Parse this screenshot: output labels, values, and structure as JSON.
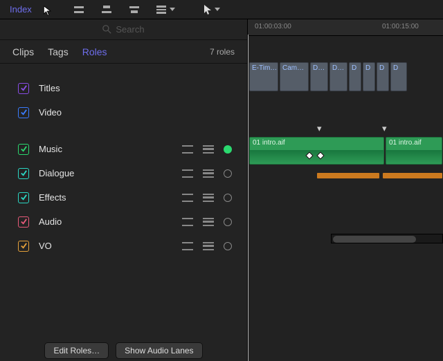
{
  "topbar": {
    "index_label": "Index"
  },
  "search": {
    "placeholder": "Search"
  },
  "tabs": {
    "clips": "Clips",
    "tags": "Tags",
    "roles": "Roles",
    "count": "7 roles"
  },
  "roles": {
    "titles": "Titles",
    "video": "Video",
    "music": "Music",
    "dialogue": "Dialogue",
    "effects": "Effects",
    "audio": "Audio",
    "vo": "VO"
  },
  "roleColors": {
    "titles": "#8a4de8",
    "video": "#3a7cff",
    "music": "#2bd96f",
    "dialogue": "#2bd9c5",
    "effects": "#2bd9c5",
    "audio": "#e85a7a",
    "vo": "#e6a13a"
  },
  "footer": {
    "edit_roles": "Edit Roles…",
    "show_audio_lanes": "Show Audio Lanes"
  },
  "timeline": {
    "tc1": "01:00:03:00",
    "tc2": "01:00:15:00",
    "playhead_box": "E-Tim…",
    "video_clips": [
      "E-Tim…",
      "Cam…",
      "D…",
      "D…",
      "D",
      "D",
      "D",
      "D"
    ],
    "audio_clip_label": "01 intro.aif"
  }
}
